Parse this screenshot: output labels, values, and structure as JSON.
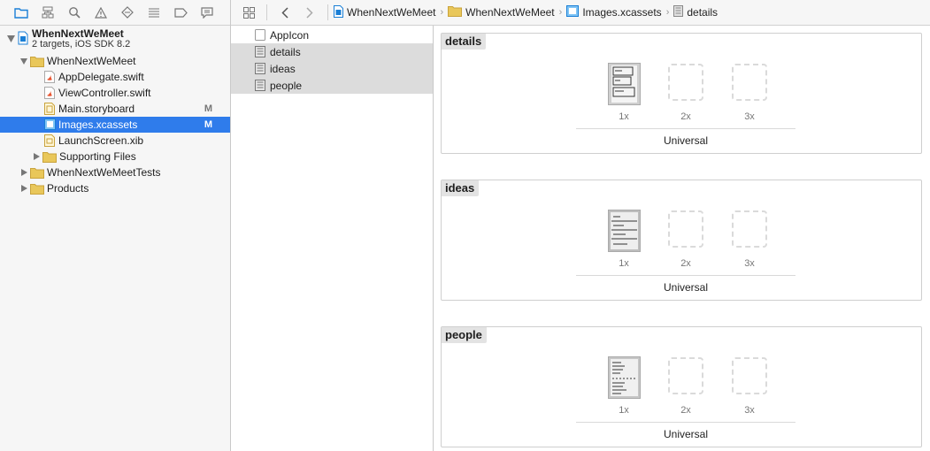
{
  "navigator": {
    "project": {
      "name": "WhenNextWeMeet",
      "subtitle": "2 targets, iOS SDK 8.2"
    },
    "items": [
      {
        "label": "WhenNextWeMeet",
        "kind": "folder",
        "depth": 1,
        "expanded": true
      },
      {
        "label": "AppDelegate.swift",
        "kind": "swift",
        "depth": 2
      },
      {
        "label": "ViewController.swift",
        "kind": "swift",
        "depth": 2
      },
      {
        "label": "Main.storyboard",
        "kind": "storyboard",
        "depth": 2,
        "badge": "M"
      },
      {
        "label": "Images.xcassets",
        "kind": "xcassets",
        "depth": 2,
        "badge": "M",
        "selected": true
      },
      {
        "label": "LaunchScreen.xib",
        "kind": "xib",
        "depth": 2
      },
      {
        "label": "Supporting Files",
        "kind": "folder",
        "depth": 2,
        "expanded": false
      },
      {
        "label": "WhenNextWeMeetTests",
        "kind": "folder",
        "depth": 1,
        "expanded": false
      },
      {
        "label": "Products",
        "kind": "folder",
        "depth": 1,
        "expanded": false
      }
    ],
    "toolbar_icons": [
      "folder-icon",
      "hierarchy-icon",
      "search-icon",
      "warning-icon",
      "test-icon",
      "debug-icon",
      "breakpoint-icon",
      "report-icon"
    ]
  },
  "jumpbar": {
    "crumbs": [
      "WhenNextWeMeet",
      "WhenNextWeMeet",
      "Images.xcassets",
      "details"
    ]
  },
  "asset_list": [
    {
      "label": "AppIcon",
      "highlighted": false
    },
    {
      "label": "details",
      "highlighted": true
    },
    {
      "label": "ideas",
      "highlighted": true
    },
    {
      "label": "people",
      "highlighted": true
    }
  ],
  "image_sets": [
    {
      "name": "details",
      "scales": [
        "1x",
        "2x",
        "3x"
      ],
      "filled": [
        true,
        false,
        false
      ],
      "idiom": "Universal"
    },
    {
      "name": "ideas",
      "scales": [
        "1x",
        "2x",
        "3x"
      ],
      "filled": [
        true,
        false,
        false
      ],
      "idiom": "Universal"
    },
    {
      "name": "people",
      "scales": [
        "1x",
        "2x",
        "3x"
      ],
      "filled": [
        true,
        false,
        false
      ],
      "idiom": "Universal"
    }
  ],
  "colors": {
    "selection": "#2f7ceb",
    "accent_icon": "#1a7fd6",
    "folder": "#e9c75a"
  }
}
